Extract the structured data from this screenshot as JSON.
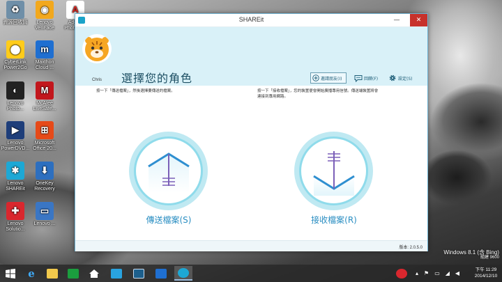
{
  "desktop": {
    "icons": [
      {
        "label": "資源回收筒",
        "color": "#6f8fa8",
        "glyph": "♻"
      },
      {
        "label": "Lenovo VeriFace",
        "color": "#f2a81d",
        "glyph": "◉"
      },
      {
        "label": "Adobe Photosh...",
        "color": "#ffffff",
        "glyph": "A"
      },
      {
        "label": "CyberLink Power2Go",
        "color": "#ffcc1a",
        "glyph": "⬤"
      },
      {
        "label": "Maxthon Cloud ...",
        "color": "#1f6fd1",
        "glyph": "m"
      },
      {
        "label": "Lenovo Photo...",
        "color": "#222222",
        "glyph": "◐"
      },
      {
        "label": "McAfee LiveSafe...",
        "color": "#c2171d",
        "glyph": "M"
      },
      {
        "label": "Lenovo PowerDVD...",
        "color": "#1e3e7a",
        "glyph": "▶"
      },
      {
        "label": "Microsoft Office 20...",
        "color": "#e64a19",
        "glyph": "⊞"
      },
      {
        "label": "Lenovo SHAREit",
        "color": "#1da8d5",
        "glyph": "✱"
      },
      {
        "label": "OneKey Recovery",
        "color": "#2d6fbf",
        "glyph": "⬇"
      },
      {
        "label": "Lenovo Solutio...",
        "color": "#d9272e",
        "glyph": "✚"
      },
      {
        "label": "Lenovo ...",
        "color": "#3a76c4",
        "glyph": "▭"
      }
    ]
  },
  "window": {
    "title": "SHAREit",
    "controls": {
      "minimize": "—",
      "maximize": "☐",
      "close": "✕"
    },
    "user_name": "Chris",
    "heading": "選擇您的角色",
    "actions": {
      "invite": "邀請朋友(I)",
      "feedback": "回饋(F)",
      "settings": "設定(S)"
    },
    "send_hint": "按一下「傳送檔案」，然後選擇要傳送的檔案。",
    "receive_hint": "按一下「接收檔案」，您的裝置便會開始廣播專用信號。傳送端裝置將會連接到專用網路。",
    "send_label": "傳送檔案(S)",
    "receive_label": "接收檔案(R)",
    "version": "版本: 2.0.5.0"
  },
  "taskbar": {
    "clock_time": "下午 11:29",
    "clock_date": "2014/12/10"
  },
  "watermark": {
    "line1": "Windows 8.1 (含 Bing)",
    "line2": "組建 9600"
  },
  "colors": {
    "accent": "#1aa3c9",
    "header_bg": "#d9f1f8",
    "role_label": "#2a8ec2"
  }
}
